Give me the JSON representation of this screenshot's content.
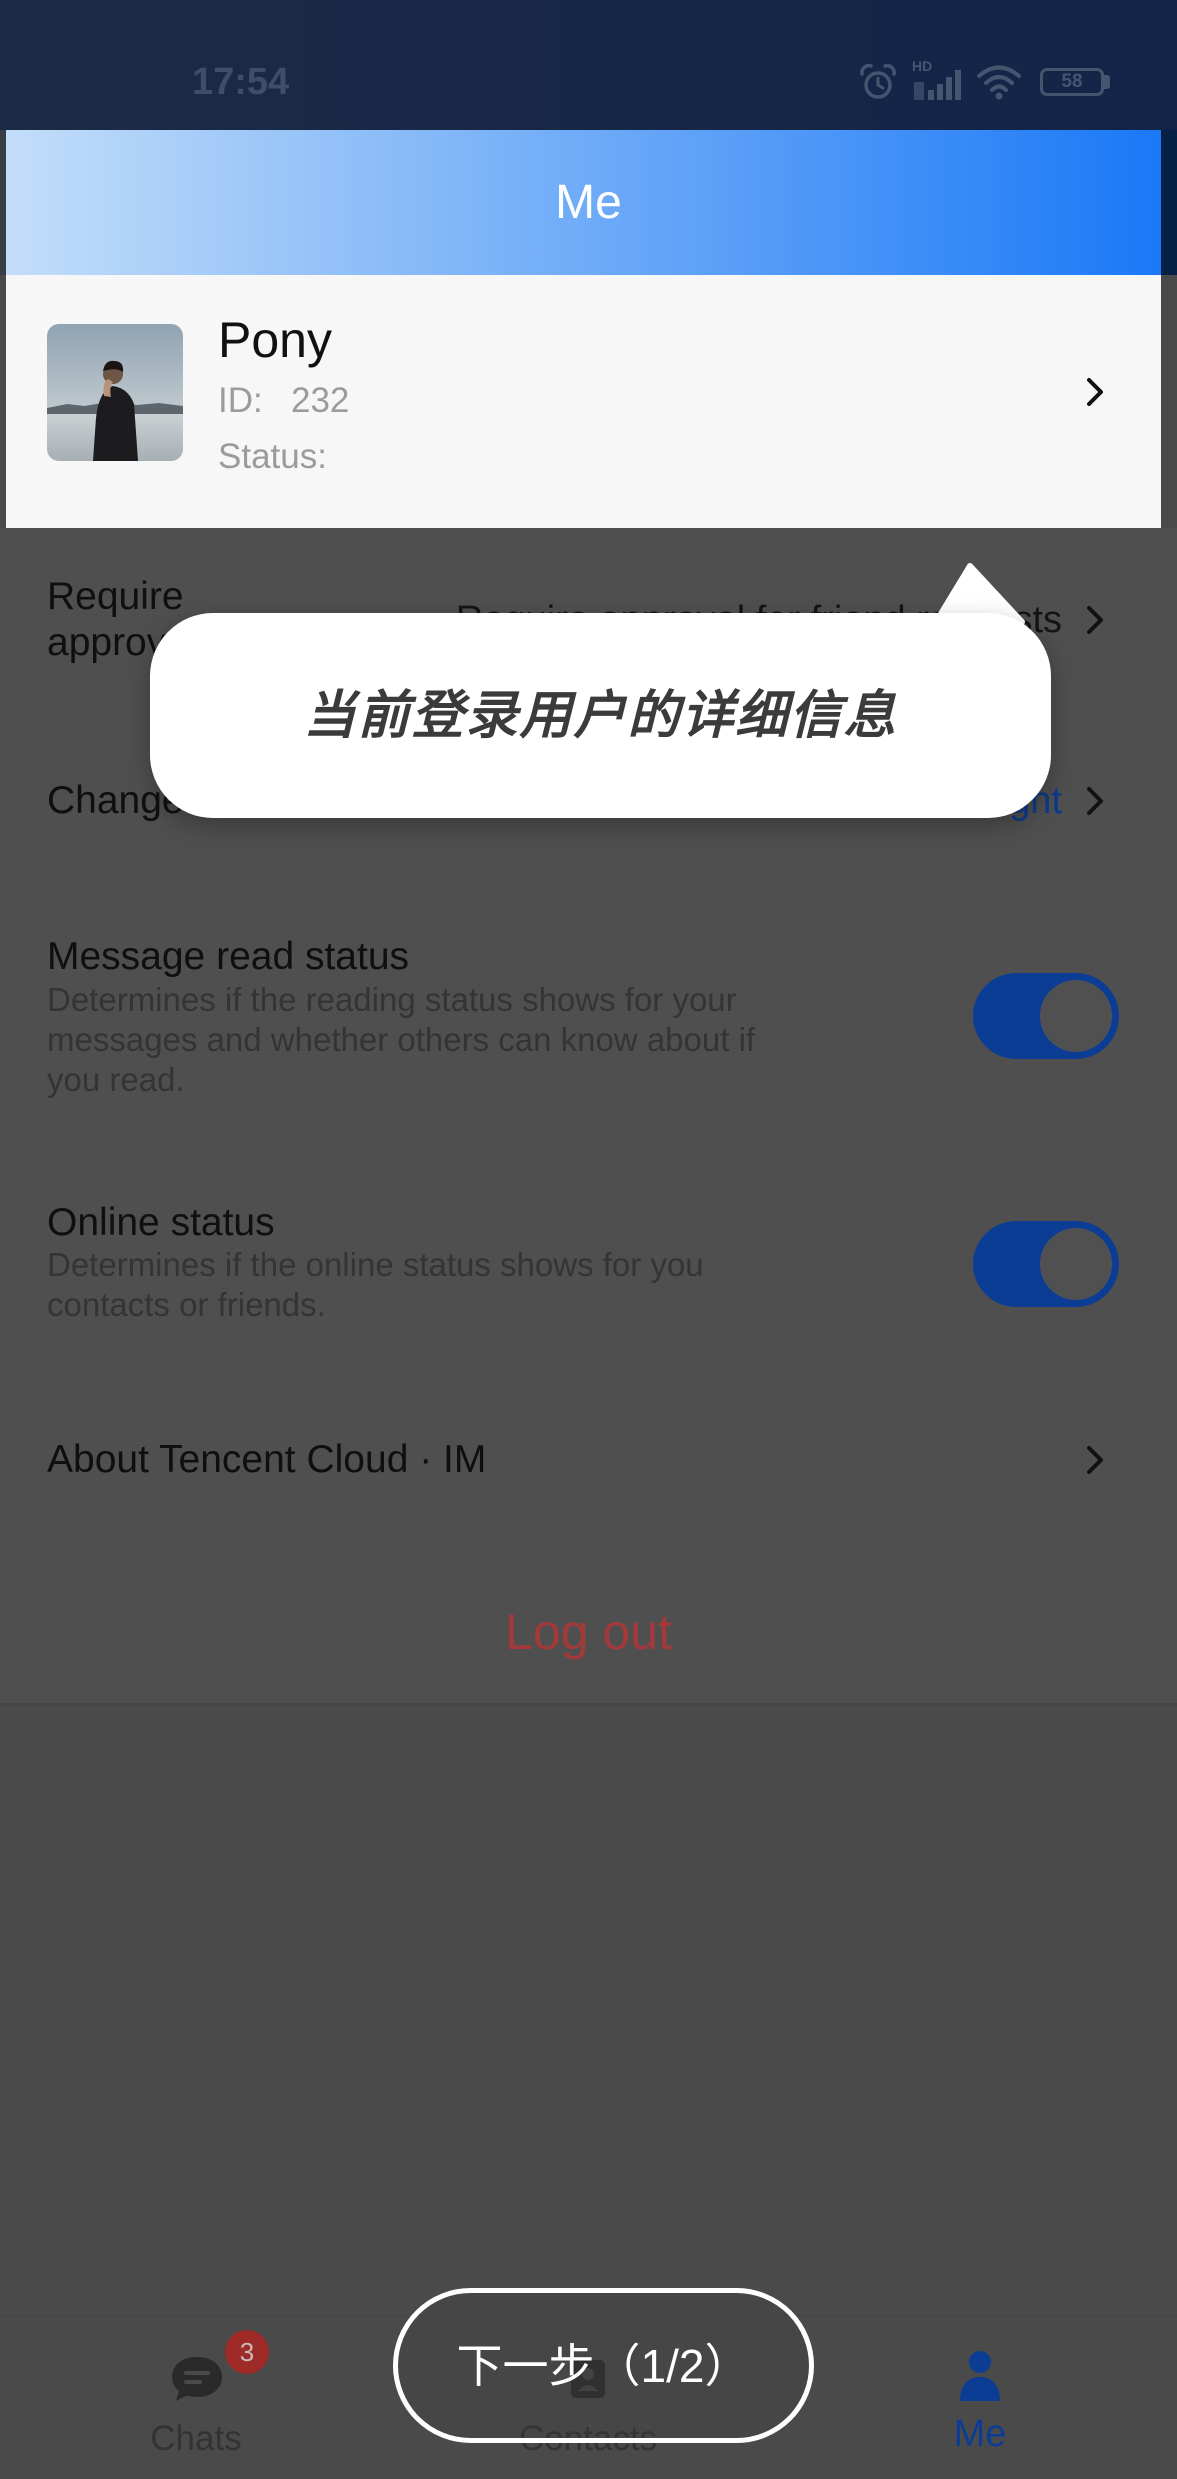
{
  "status_bar": {
    "time": "17:54",
    "network": "HD",
    "battery": "58",
    "icons": [
      "alarm-icon",
      "signal-icon",
      "wifi-icon",
      "battery-icon"
    ]
  },
  "header": {
    "title": "Me"
  },
  "profile": {
    "name": "Pony",
    "id_label": "ID:",
    "id_value": "232",
    "status_label": "Status:"
  },
  "settings": {
    "friend_approval": {
      "label": "Require approval",
      "value": "Require approval for friend requests"
    },
    "theme": {
      "label": "Change theme",
      "value": "Light"
    },
    "read_status": {
      "label": "Message read status",
      "description_lines": [
        "Determines if the reading status shows for your",
        "messages and whether others can know about if",
        "you read."
      ],
      "enabled": true
    },
    "online_status": {
      "label": "Online status",
      "description_lines": [
        "Determines if the online status shows for you",
        "contacts or friends."
      ],
      "enabled": true
    },
    "about": {
      "label": "About Tencent Cloud · IM"
    }
  },
  "logout_label": "Log out",
  "tab_bar": {
    "items": [
      {
        "label": "Chats",
        "icon": "chat-icon",
        "badge": "3",
        "active": false
      },
      {
        "label": "Contacts",
        "icon": "contacts-icon",
        "active": false
      },
      {
        "label": "Me",
        "icon": "person-icon",
        "active": true
      }
    ]
  },
  "guide": {
    "tooltip": "当前登录用户的详细信息",
    "next_label": "下一步（1/2）"
  },
  "colors": {
    "header_gradient_start": "#c4def9",
    "header_gradient_end": "#1877f7",
    "toggle_on": "#0b3d94",
    "logout": "#a3393a",
    "badge": "#9e2b28",
    "link": "#0b3a8c"
  }
}
